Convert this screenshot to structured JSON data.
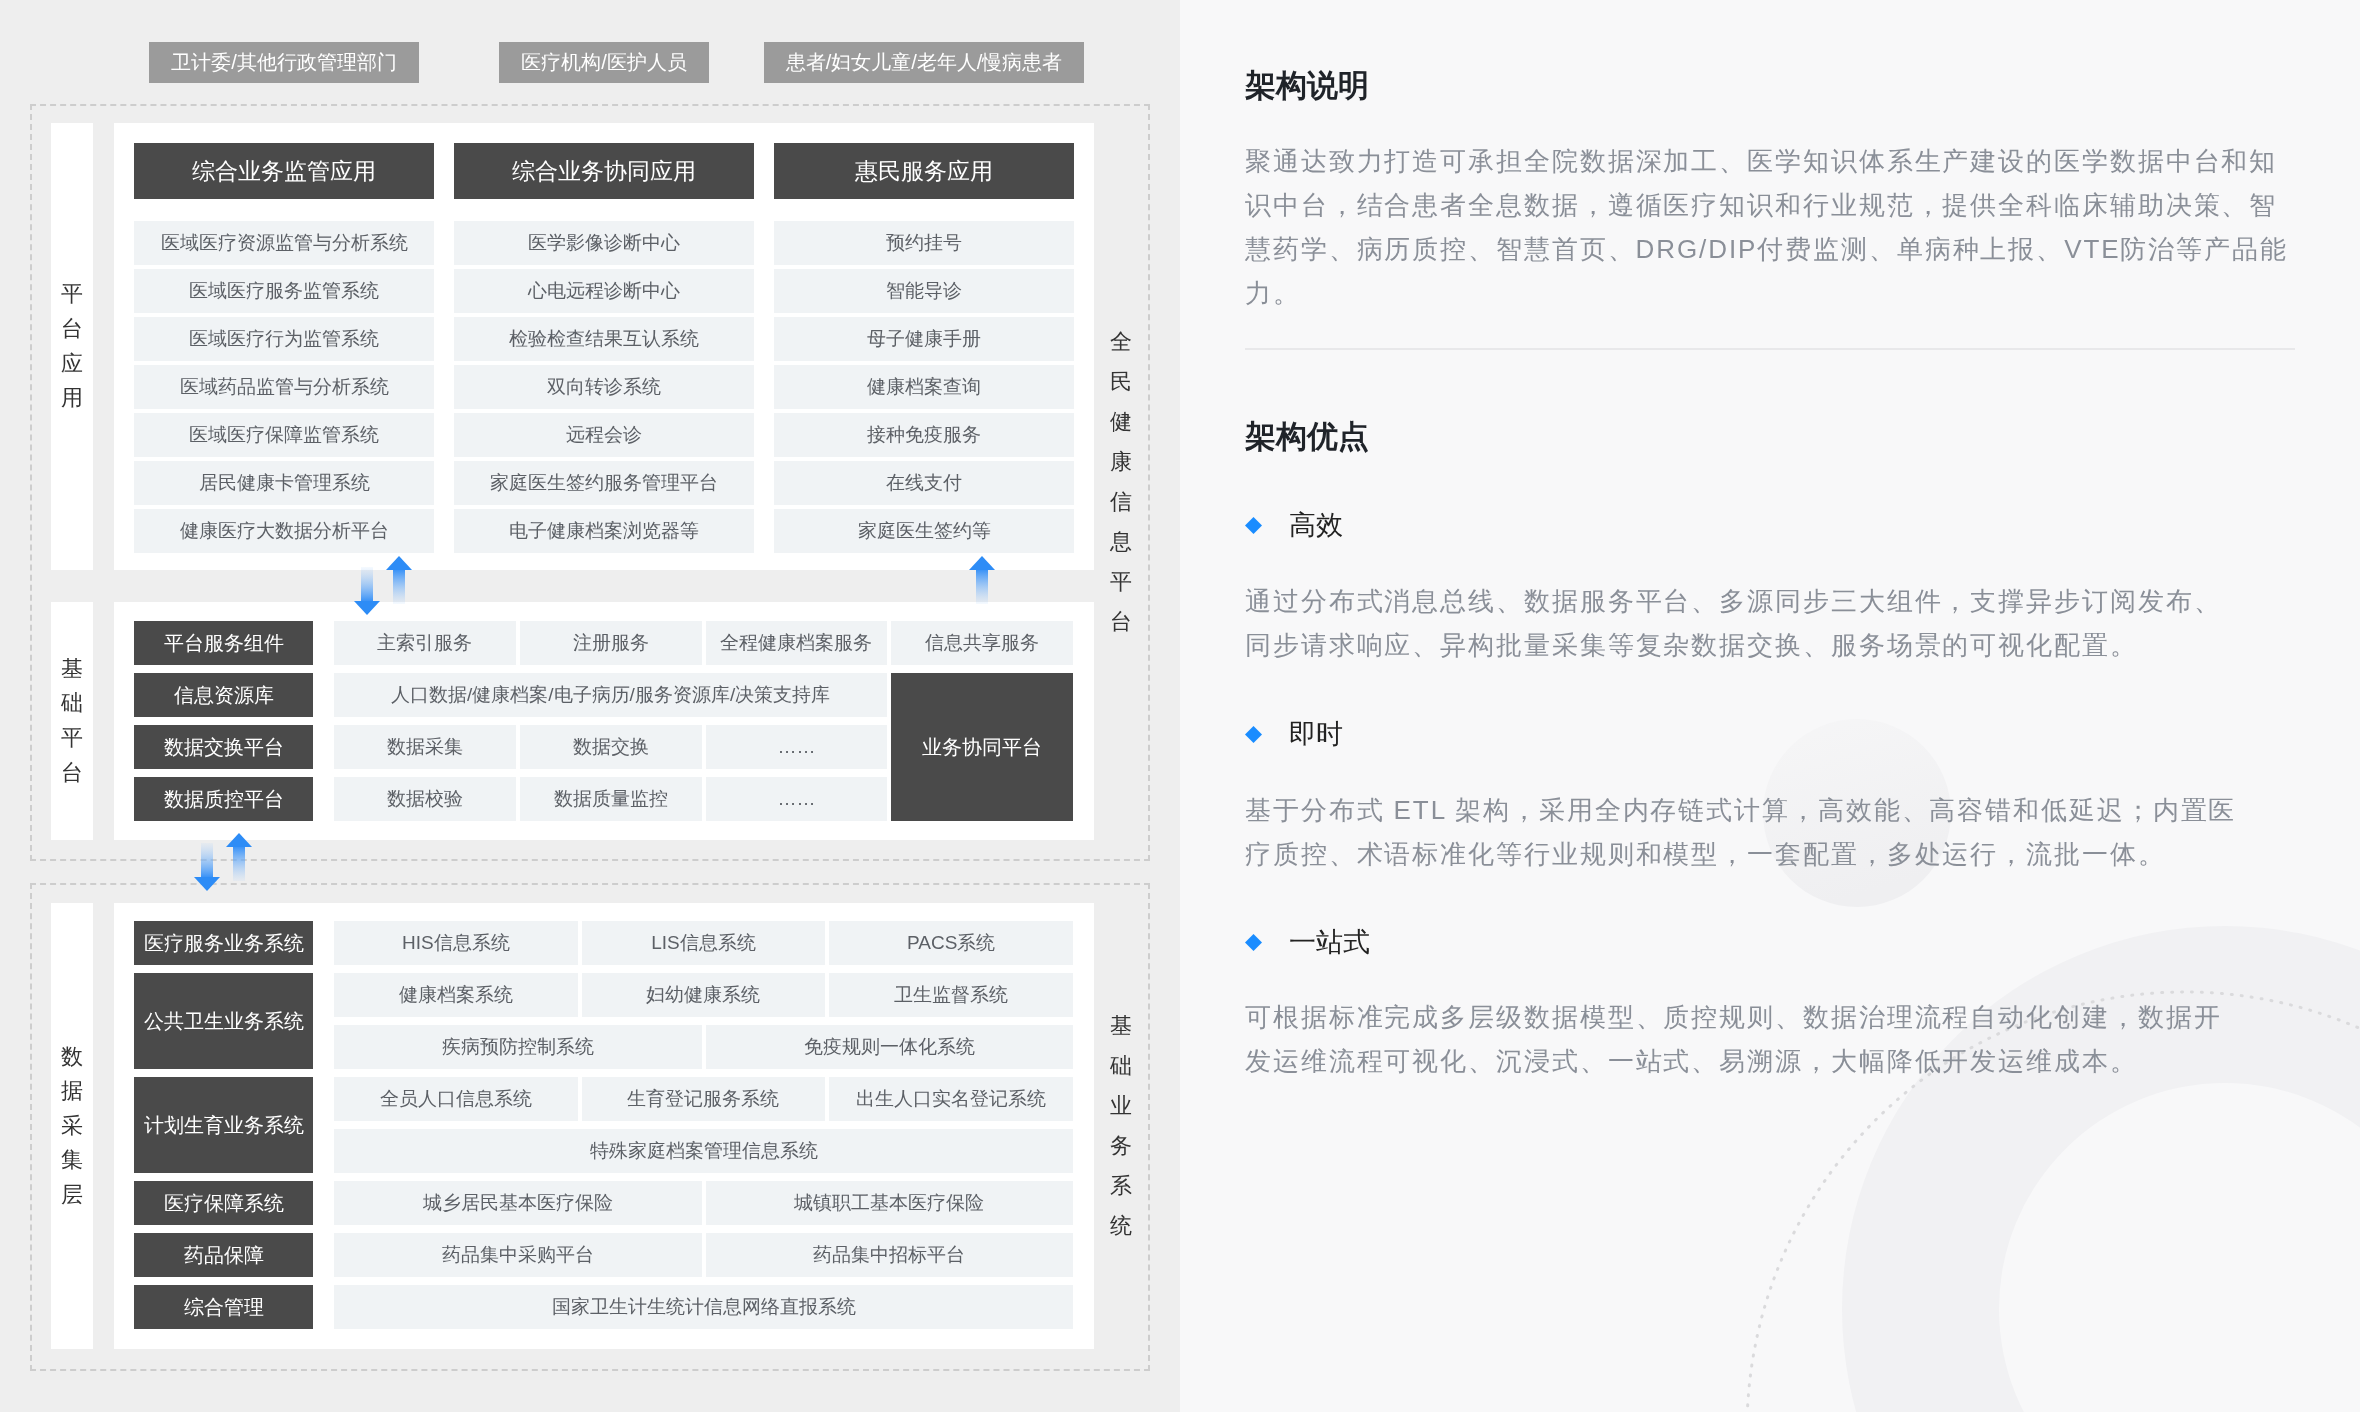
{
  "user_groups": [
    "卫计委/其他行政管理部门",
    "医疗机构/医护人员",
    "患者/妇女儿童/老年人/慢病患者"
  ],
  "health_information_platform": {
    "side_label": "全民健康信息平台",
    "platform_applications": {
      "label": "平台应用",
      "columns": [
        {
          "title": "综合业务监管应用",
          "items": [
            "医域医疗资源监管与分析系统",
            "医域医疗服务监管系统",
            "医域医疗行为监管系统",
            "医域药品监管与分析系统",
            "医域医疗保障监管系统",
            "居民健康卡管理系统",
            "健康医疗大数据分析平台"
          ]
        },
        {
          "title": "综合业务协同应用",
          "items": [
            "医学影像诊断中心",
            "心电远程诊断中心",
            "检验检查结果互认系统",
            "双向转诊系统",
            "远程会诊",
            "家庭医生签约服务管理平台",
            "电子健康档案浏览器等"
          ]
        },
        {
          "title": "惠民服务应用",
          "items": [
            "预约挂号",
            "智能导诊",
            "母子健康手册",
            "健康档案查询",
            "接种免疫服务",
            "在线支付",
            "家庭医生签约等"
          ]
        }
      ]
    },
    "basic_platform": {
      "label": "基础平台",
      "components": [
        "平台服务组件",
        "信息资源库",
        "数据交换平台",
        "数据质控平台"
      ],
      "rows": [
        [
          "主索引服务",
          "注册服务",
          "全程健康档案服务",
          "信息共享服务"
        ],
        [
          "人口数据/健康档案/电子病历/服务资源库/决策支持库"
        ],
        [
          "数据采集",
          "数据交换",
          "……"
        ],
        [
          "数据校验",
          "数据质量监控",
          "……"
        ]
      ],
      "side_block": "业务协同平台"
    }
  },
  "basic_business_systems": {
    "side_label": "基础业务系统",
    "data_collection_layer": {
      "label": "数据采集层",
      "groups": [
        {
          "name": "医疗服务业务系统",
          "rows": [
            [
              {
                "text": "HIS信息系统",
                "colspan": 2
              },
              {
                "text": "LIS信息系统",
                "colspan": 2
              },
              {
                "text": "PACS系统",
                "colspan": 2
              }
            ]
          ]
        },
        {
          "name": "公共卫生业务系统",
          "rows": [
            [
              {
                "text": "健康档案系统",
                "colspan": 2
              },
              {
                "text": "妇幼健康系统",
                "colspan": 2
              },
              {
                "text": "卫生监督系统",
                "colspan": 2
              }
            ],
            [
              {
                "text": "疾病预防控制系统",
                "colspan": 3
              },
              {
                "text": "免疫规则一体化系统",
                "colspan": 3
              }
            ]
          ]
        },
        {
          "name": "计划生育业务系统",
          "rows": [
            [
              {
                "text": "全员人口信息系统",
                "colspan": 2
              },
              {
                "text": "生育登记服务系统",
                "colspan": 2
              },
              {
                "text": "出生人口实名登记系统",
                "colspan": 2
              }
            ],
            [
              {
                "text": "特殊家庭档案管理信息系统",
                "colspan": 6
              }
            ]
          ]
        },
        {
          "name": "医疗保障系统",
          "rows": [
            [
              {
                "text": "城乡居民基本医疗保险",
                "colspan": 3
              },
              {
                "text": "城镇职工基本医疗保险",
                "colspan": 3
              }
            ]
          ]
        },
        {
          "name": "药品保障",
          "rows": [
            [
              {
                "text": "药品集中采购平台",
                "colspan": 3
              },
              {
                "text": "药品集中招标平台",
                "colspan": 3
              }
            ]
          ]
        },
        {
          "name": "综合管理",
          "rows": [
            [
              {
                "text": "国家卫生计生统计信息网络直报系统",
                "colspan": 6
              }
            ]
          ]
        }
      ]
    }
  },
  "architecture_description": {
    "title": "架构说明",
    "text": "聚通达致力打造可承担全院数据深加工、医学知识体系生产建设的医学数据中台和知识中台，结合患者全息数据，遵循医疗知识和行业规范，提供全科临床辅助决策、智慧药学、病历质控、智慧首页、DRG/DIP付费监测、单病种上报、VTE防治等产品能力。"
  },
  "architecture_advantages": {
    "title": "架构优点",
    "items": [
      {
        "title": "高效",
        "text": "通过分布式消息总线、数据服务平台、多源同步三大组件，支撑异步订阅发布、同步请求响应、异构批量采集等复杂数据交换、服务场景的可视化配置。"
      },
      {
        "title": "即时",
        "text": "基于分布式 ETL 架构，采用全内存链式计算，高效能、高容错和低延迟；内置医疗质控、术语标准化等行业规则和模型，一套配置，多处运行，流批一体。"
      },
      {
        "title": "一站式",
        "text": "可根据标准完成多层级数据模型、质控规则、数据治理流程自动化创建，数据开发运维流程可视化、沉浸式、一站式、易溯源，大幅降低开发运维成本。"
      }
    ]
  }
}
